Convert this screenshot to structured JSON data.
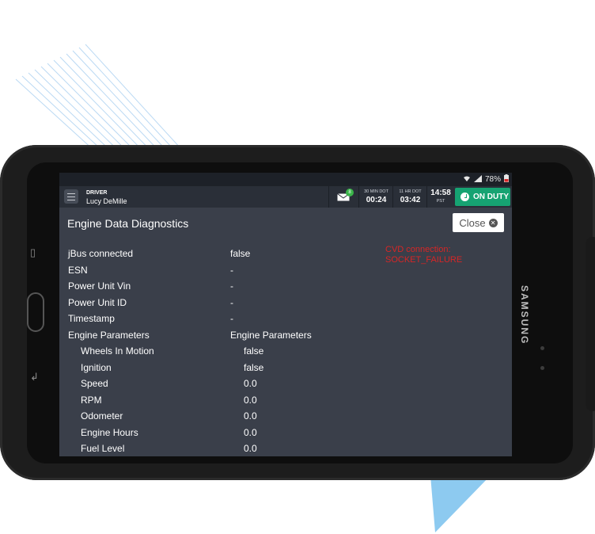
{
  "device": {
    "brand": "SAMSUNG"
  },
  "status_bar": {
    "battery": "78%"
  },
  "header": {
    "role_label": "DRIVER",
    "driver_name": "Lucy DeMille",
    "message_badge": "8",
    "timers": [
      {
        "label": "30 MIN DOT",
        "value": "00:24"
      },
      {
        "label": "11 HR DOT",
        "value": "03:42"
      }
    ],
    "clock": {
      "time": "14:58",
      "tz": "PST"
    },
    "duty_status": "ON DUTY"
  },
  "page": {
    "title": "Engine Data Diagnostics",
    "close_label": "Close",
    "error_lines": [
      "CVD connection:",
      "SOCKET_FAILURE"
    ]
  },
  "rows": [
    {
      "key": "jBus connected",
      "value": "false",
      "indent": false
    },
    {
      "key": "ESN",
      "value": "-",
      "indent": false
    },
    {
      "key": "Power Unit Vin",
      "value": "-",
      "indent": false
    },
    {
      "key": "Power Unit ID",
      "value": "-",
      "indent": false
    },
    {
      "key": "Timestamp",
      "value": "-",
      "indent": false
    },
    {
      "key": "Engine Parameters",
      "value": "Engine Parameters",
      "indent": false
    },
    {
      "key": "Wheels In Motion",
      "value": "false",
      "indent": true
    },
    {
      "key": "Ignition",
      "value": "false",
      "indent": true
    },
    {
      "key": "Speed",
      "value": "0.0",
      "indent": true
    },
    {
      "key": "RPM",
      "value": "0.0",
      "indent": true
    },
    {
      "key": "Odometer",
      "value": "0.0",
      "indent": true
    },
    {
      "key": "Engine Hours",
      "value": "0.0",
      "indent": true
    },
    {
      "key": "Fuel Level",
      "value": "0.0",
      "indent": true
    }
  ],
  "colors": {
    "screen_bg": "#3a3f4a",
    "duty_green": "#16a372",
    "error_red": "#d72626"
  }
}
